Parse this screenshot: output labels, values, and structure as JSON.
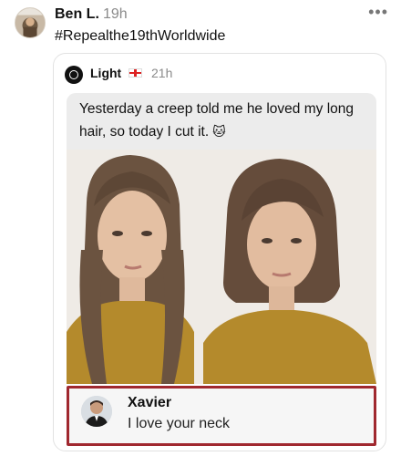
{
  "post": {
    "author": "Ben L.",
    "time": "19h",
    "more_icon": "ellipsis-icon",
    "text": "#Repealthe19thWorldwide"
  },
  "quoted": {
    "author": "Light",
    "flag_icon": "england-flag-icon",
    "time": "21h",
    "caption": "Yesterday a creep told me he loved my long hair, so today I cut it.",
    "caption_emoji": "🐱",
    "image_description_icon": "before-after-haircut-photo"
  },
  "reply": {
    "author": "Xavier",
    "text": "I love your neck",
    "highlight_color": "#a0282f"
  }
}
